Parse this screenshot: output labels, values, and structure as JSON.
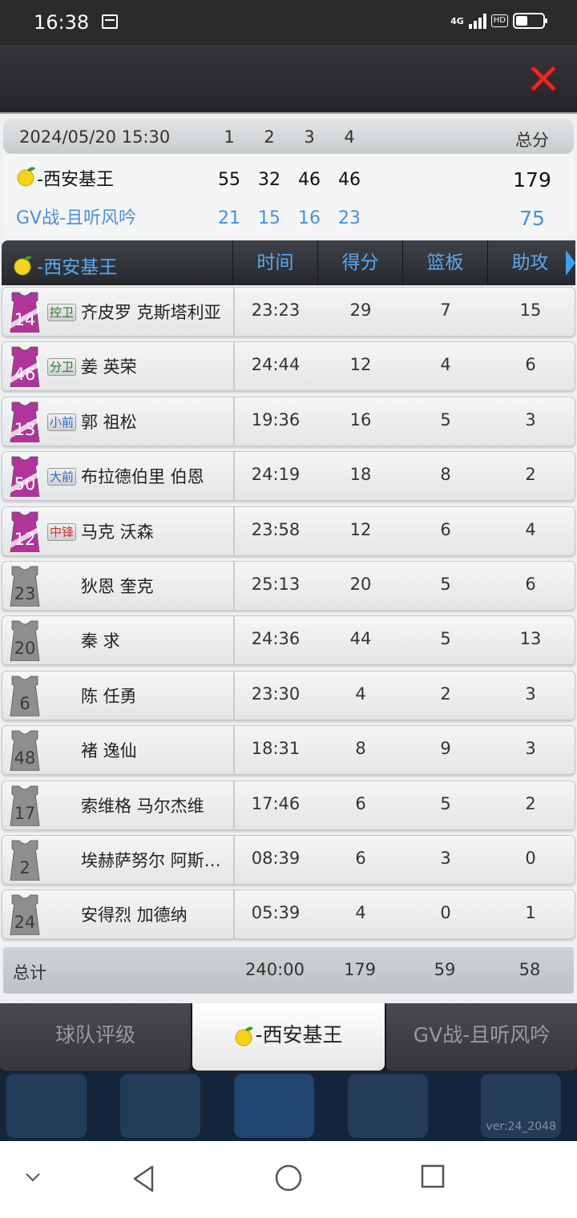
{
  "status_bar": {
    "time": "16:38",
    "network": "4G",
    "hd": "HD"
  },
  "score": {
    "datetime": "2024/05/20 15:30",
    "quarters": [
      "1",
      "2",
      "3",
      "4"
    ],
    "total_label": "总分",
    "team_a": {
      "name": "-西安基王",
      "q": [
        "55",
        "32",
        "46",
        "46"
      ],
      "total": "179"
    },
    "team_b": {
      "name": "GV战-且听风吟",
      "q": [
        "21",
        "15",
        "16",
        "23"
      ],
      "total": "75"
    }
  },
  "table": {
    "team_name": "-西安基王",
    "columns": [
      "时间",
      "得分",
      "篮板",
      "助攻"
    ],
    "players": [
      {
        "number": "14",
        "starter": true,
        "position": "控卫",
        "pos_color": "#2d7a2d",
        "name": "齐皮罗 克斯塔利亚",
        "time": "23:23",
        "pts": "29",
        "reb": "7",
        "ast": "15"
      },
      {
        "number": "46",
        "starter": true,
        "position": "分卫",
        "pos_color": "#2d7a2d",
        "name": "姜 英荣",
        "time": "24:44",
        "pts": "12",
        "reb": "4",
        "ast": "6"
      },
      {
        "number": "13",
        "starter": true,
        "position": "小前",
        "pos_color": "#2f6fc0",
        "name": "郭 祖松",
        "time": "19:36",
        "pts": "16",
        "reb": "5",
        "ast": "3"
      },
      {
        "number": "50",
        "starter": true,
        "position": "大前",
        "pos_color": "#2f6fc0",
        "name": "布拉德伯里 伯恩",
        "time": "24:19",
        "pts": "18",
        "reb": "8",
        "ast": "2"
      },
      {
        "number": "12",
        "starter": true,
        "position": "中锋",
        "pos_color": "#d0342c",
        "name": "马克 沃森",
        "time": "23:58",
        "pts": "12",
        "reb": "6",
        "ast": "4"
      },
      {
        "number": "23",
        "starter": false,
        "position": "",
        "pos_color": "",
        "name": "狄恩 奎克",
        "time": "25:13",
        "pts": "20",
        "reb": "5",
        "ast": "6"
      },
      {
        "number": "20",
        "starter": false,
        "position": "",
        "pos_color": "",
        "name": "秦 求",
        "time": "24:36",
        "pts": "44",
        "reb": "5",
        "ast": "13"
      },
      {
        "number": "6",
        "starter": false,
        "position": "",
        "pos_color": "",
        "name": "陈 任勇",
        "time": "23:30",
        "pts": "4",
        "reb": "2",
        "ast": "3"
      },
      {
        "number": "48",
        "starter": false,
        "position": "",
        "pos_color": "",
        "name": "褚 逸仙",
        "time": "18:31",
        "pts": "8",
        "reb": "9",
        "ast": "3"
      },
      {
        "number": "17",
        "starter": false,
        "position": "",
        "pos_color": "",
        "name": "索维格 马尔杰维",
        "time": "17:46",
        "pts": "6",
        "reb": "5",
        "ast": "2"
      },
      {
        "number": "2",
        "starter": false,
        "position": "",
        "pos_color": "",
        "name": "埃赫萨努尔 阿斯…",
        "time": "08:39",
        "pts": "6",
        "reb": "3",
        "ast": "0"
      },
      {
        "number": "24",
        "starter": false,
        "position": "",
        "pos_color": "",
        "name": "安得烈 加德纳",
        "time": "05:39",
        "pts": "4",
        "reb": "0",
        "ast": "1"
      }
    ],
    "totals": {
      "label": "总计",
      "time": "240:00",
      "pts": "179",
      "reb": "59",
      "ast": "58"
    }
  },
  "tabs": [
    {
      "label": "球队评级",
      "active": false
    },
    {
      "label": "-西安基王",
      "active": true
    },
    {
      "label": "GV战-且听风吟",
      "active": false
    }
  ],
  "version": "ver:24_2048",
  "colors": {
    "starter_jersey": "#b0349a",
    "bench_jersey": "#8e8e8e",
    "team_b_blue": "#4a90d9",
    "header_blue": "#5aa8f0",
    "close_red": "#e0302a"
  },
  "icons": {
    "close": "close-x-icon",
    "team_logo": "lemon-icon",
    "jersey": "jersey-icon"
  }
}
